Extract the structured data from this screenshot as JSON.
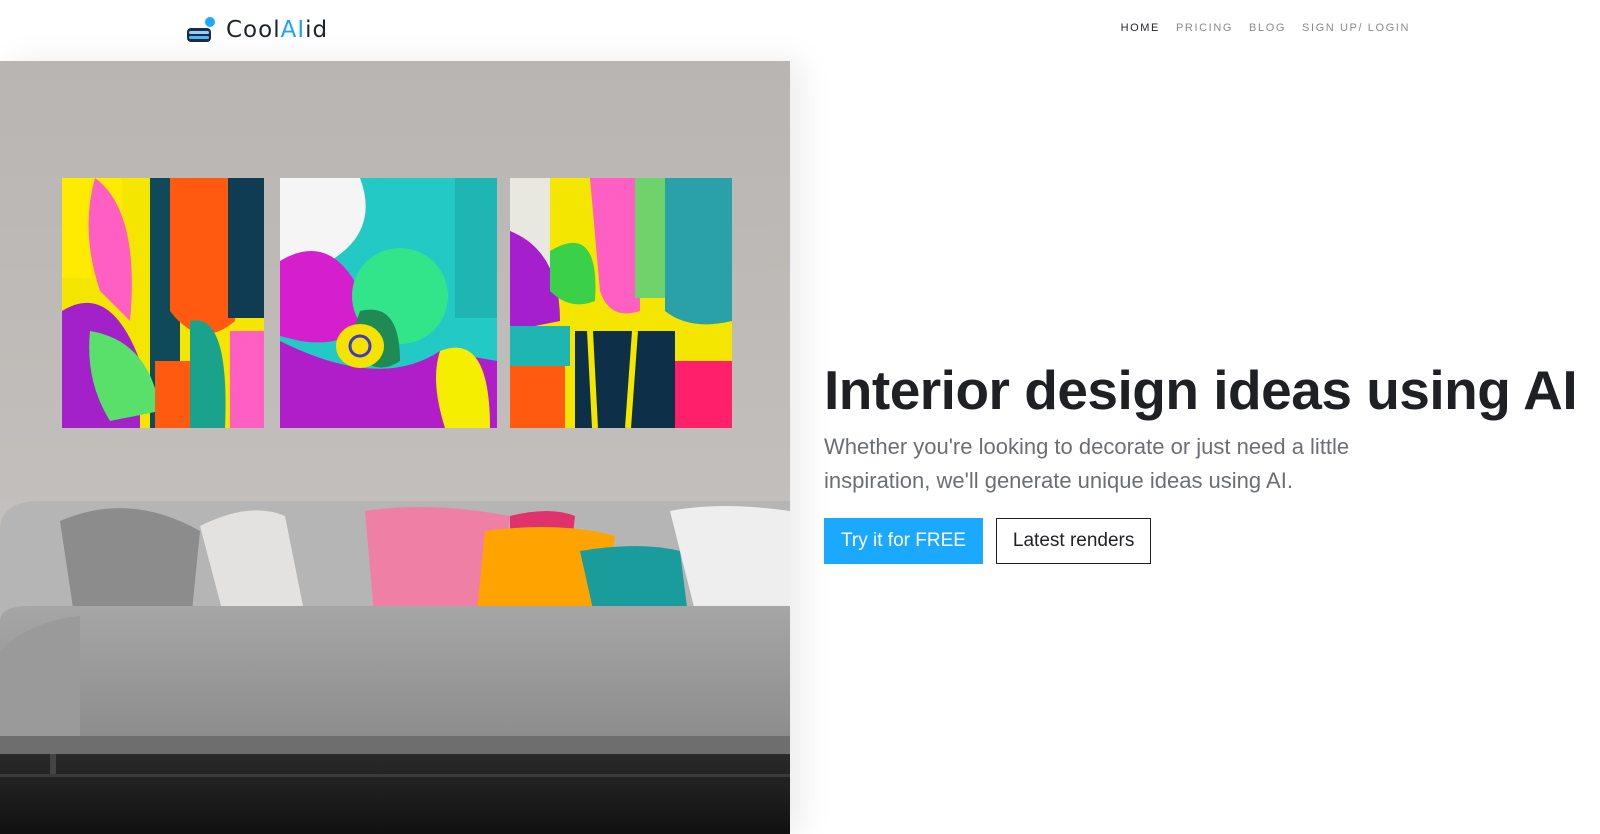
{
  "brand": {
    "name_prefix": "Cool",
    "name_accent": "AI",
    "name_suffix": "id",
    "accent_color": "#1aa9ff"
  },
  "nav": {
    "items": [
      {
        "label": "HOME",
        "active": true
      },
      {
        "label": "PRICING",
        "active": false
      },
      {
        "label": "BLOG",
        "active": false
      },
      {
        "label": "SIGN UP/ LOGIN",
        "active": false
      }
    ]
  },
  "hero": {
    "title": "Interior design ideas using AI",
    "subtitle": "Whether you're looking to decorate or just need a little inspiration, we'll generate unique ideas using AI.",
    "primary_button": "Try it for FREE",
    "secondary_button": "Latest renders"
  }
}
